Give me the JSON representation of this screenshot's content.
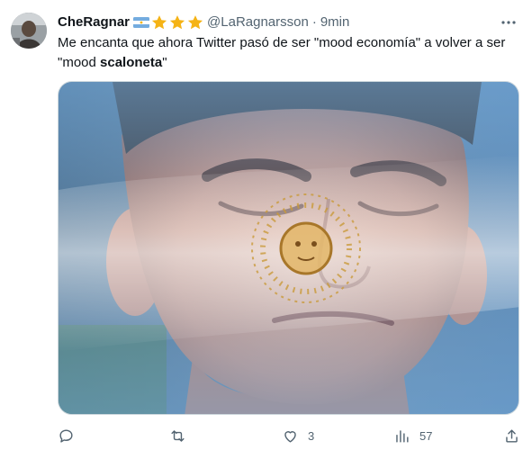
{
  "tweet": {
    "author": {
      "display_name": "CheRagnar",
      "handle": "@LaRagnarsson",
      "badges": [
        "argentina-flag-icon",
        "star-icon",
        "star-icon",
        "star-icon"
      ]
    },
    "separator": "·",
    "time": "9min",
    "text_before": "Me encanta que ahora Twitter pasó de ser \"mood economía\" a volver a ser \"mood ",
    "text_bold": "scaloneta",
    "text_after": "\"",
    "media_alt": "",
    "actions": {
      "reply_count": "",
      "retweet_count": "",
      "like_count": "3",
      "views_count": "57",
      "share_count": ""
    }
  },
  "colors": {
    "text": "#0f1419",
    "secondary": "#536471",
    "border": "#cfd9de",
    "star": "#f5b316",
    "flag_blue": "#74acdf",
    "sun": "#d4a017"
  }
}
